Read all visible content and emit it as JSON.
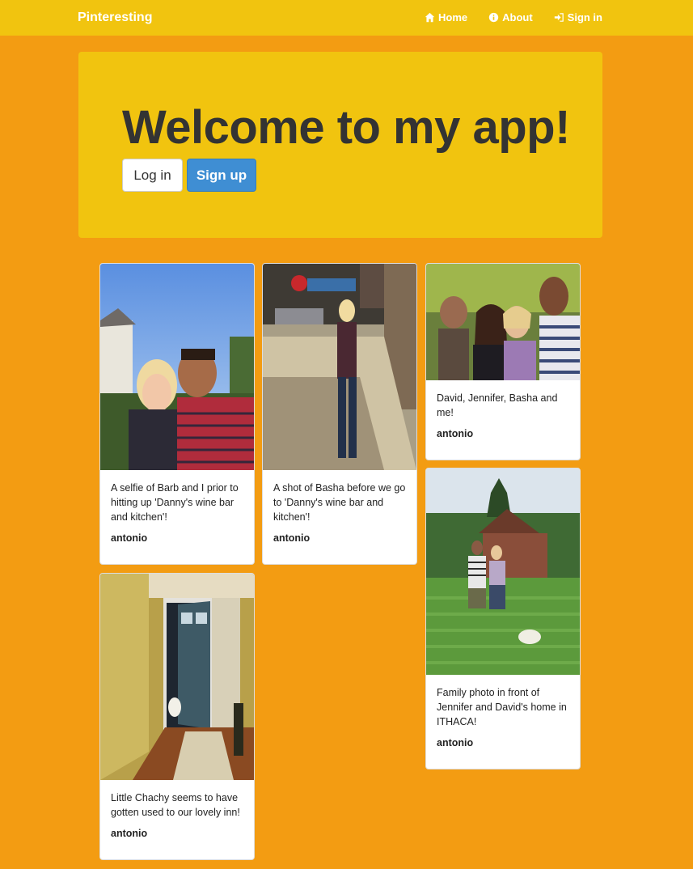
{
  "navbar": {
    "brand": "Pinteresting",
    "links": [
      {
        "label": "Home",
        "icon": "home-icon"
      },
      {
        "label": "About",
        "icon": "info-icon"
      },
      {
        "label": "Sign in",
        "icon": "sign-in-icon"
      }
    ]
  },
  "jumbotron": {
    "title": "Welcome to my app!",
    "login_label": "Log in",
    "signup_label": "Sign up"
  },
  "pins": [
    {
      "caption": "A selfie of Barb and I prior to hitting up 'Danny's wine bar and kitchen'!",
      "author": "antonio",
      "image": "selfie couple photo"
    },
    {
      "caption": "A shot of Basha before we go to 'Danny's wine bar and kitchen'!",
      "author": "antonio",
      "image": "woman on sidewalk photo"
    },
    {
      "caption": "David, Jennifer, Basha and me!",
      "author": "antonio",
      "image": "group of four photo"
    },
    {
      "caption": "Family photo in front of Jennifer and David's home in ITHACA!",
      "author": "antonio",
      "image": "family in yard photo"
    },
    {
      "caption": "Little Chachy seems to have gotten used to our lovely inn!",
      "author": "antonio",
      "image": "hallway with dog photo"
    }
  ],
  "colors": {
    "page_bg": "#f39c12",
    "navbar_bg": "#f1c40f",
    "primary_button": "#3f8ed3"
  }
}
